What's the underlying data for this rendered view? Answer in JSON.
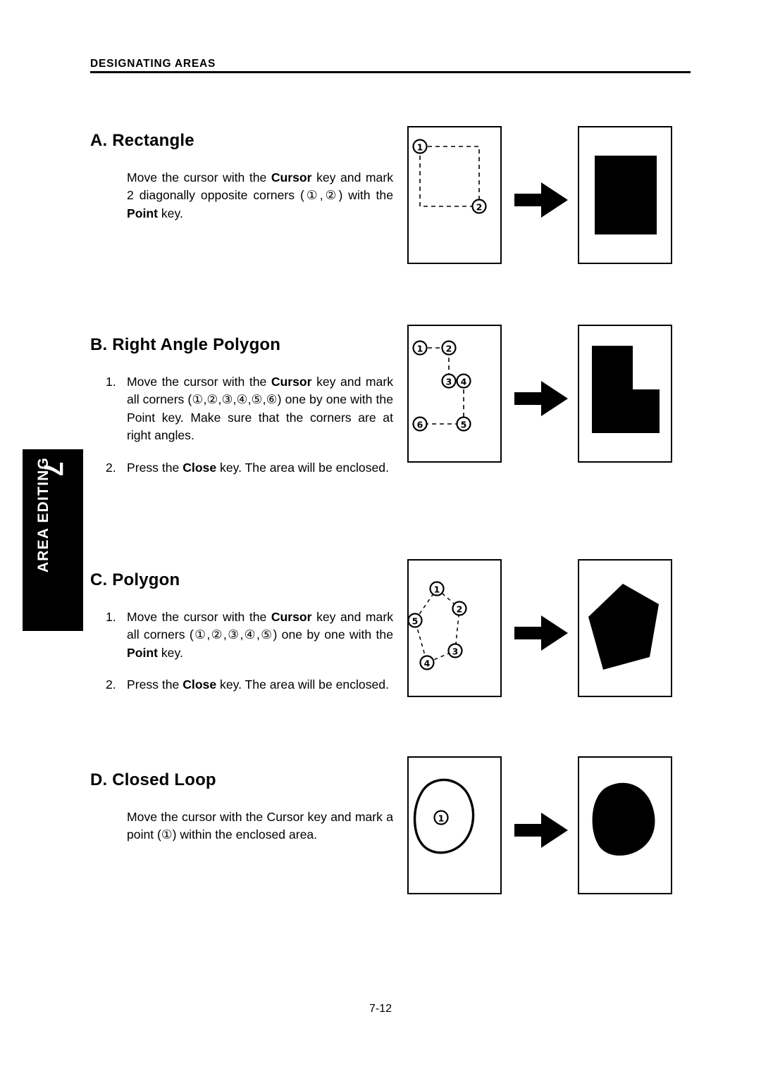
{
  "header": {
    "title": "DESIGNATING AREAS"
  },
  "side_tab": {
    "number": "7",
    "label": "AREA EDITING",
    "background_color": "#000000",
    "text_color": "#ffffff"
  },
  "sections": [
    {
      "id": "rectangle",
      "title": "A. Rectangle",
      "paragraphs": [
        {
          "marker": "",
          "runs": [
            {
              "text": "Move the cursor with the ",
              "bold": false
            },
            {
              "text": "Cursor",
              "bold": true
            },
            {
              "text": " key and mark 2 diagonally opposite corners (①,②) with the ",
              "bold": false
            },
            {
              "text": "Point",
              "bold": true
            },
            {
              "text": " key.",
              "bold": false
            }
          ]
        }
      ]
    },
    {
      "id": "right-angle-polygon",
      "title": "B. Right Angle Polygon",
      "paragraphs": [
        {
          "marker": "1.",
          "runs": [
            {
              "text": "Move the cursor with the ",
              "bold": false
            },
            {
              "text": "Cursor",
              "bold": true
            },
            {
              "text": " key and mark all corners (①,②,③,④,⑤,⑥) one by one with the Point key.  Make sure that the corners are at right angles.",
              "bold": false
            }
          ]
        },
        {
          "marker": "2.",
          "runs": [
            {
              "text": "Press the ",
              "bold": false
            },
            {
              "text": "Close",
              "bold": true
            },
            {
              "text": " key.  The area will be enclosed.",
              "bold": false
            }
          ]
        }
      ]
    },
    {
      "id": "polygon",
      "title": "C. Polygon",
      "paragraphs": [
        {
          "marker": "1.",
          "runs": [
            {
              "text": "Move the cursor with the ",
              "bold": false
            },
            {
              "text": "Cursor",
              "bold": true
            },
            {
              "text": " key and mark all corners (①,②,③,④,⑤) one by one with the ",
              "bold": false
            },
            {
              "text": "Point",
              "bold": true
            },
            {
              "text": " key.",
              "bold": false
            }
          ]
        },
        {
          "marker": "2.",
          "runs": [
            {
              "text": "Press the ",
              "bold": false
            },
            {
              "text": "Close",
              "bold": true
            },
            {
              "text": " key.  The area will be enclosed.",
              "bold": false
            }
          ]
        }
      ]
    },
    {
      "id": "closed-loop",
      "title": "D. Closed Loop",
      "paragraphs": [
        {
          "marker": "",
          "runs": [
            {
              "text": "Move the cursor with the Cursor key and mark a point (①) within the enclosed area.",
              "bold": false
            }
          ]
        }
      ]
    }
  ],
  "diagrams": [
    {
      "id": "rectangle-diagram",
      "kind": "rectangle",
      "point_labels": [
        "①",
        "②"
      ],
      "arrow": "right-block-arrow"
    },
    {
      "id": "right-angle-polygon-diagram",
      "kind": "l-shape",
      "point_labels": [
        "①",
        "②",
        "③",
        "④",
        "⑤",
        "⑥"
      ],
      "arrow": "right-block-arrow"
    },
    {
      "id": "polygon-diagram",
      "kind": "pentagon",
      "point_labels": [
        "①",
        "②",
        "③",
        "④",
        "⑤"
      ],
      "arrow": "right-block-arrow"
    },
    {
      "id": "closed-loop-diagram",
      "kind": "blob",
      "point_labels": [
        "①"
      ],
      "arrow": "right-block-arrow"
    }
  ],
  "footer": {
    "page_number": "7-12"
  }
}
